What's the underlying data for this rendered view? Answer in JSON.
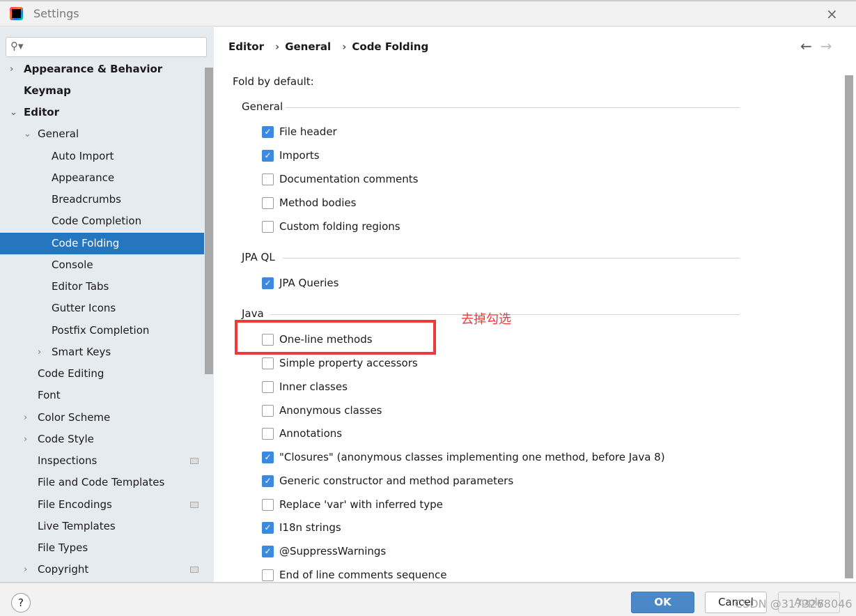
{
  "window": {
    "title": "Settings",
    "close_icon": "×"
  },
  "sidebar": {
    "search_placeholder": "",
    "items": [
      {
        "label": "Appearance & Behavior",
        "level": 0,
        "bold": true,
        "arrow": "›"
      },
      {
        "label": "Keymap",
        "level": 0,
        "bold": true
      },
      {
        "label": "Editor",
        "level": 0,
        "bold": true,
        "arrow": "⌄"
      },
      {
        "label": "General",
        "level": 1,
        "arrow": "⌄"
      },
      {
        "label": "Auto Import",
        "level": 2
      },
      {
        "label": "Appearance",
        "level": 2
      },
      {
        "label": "Breadcrumbs",
        "level": 2
      },
      {
        "label": "Code Completion",
        "level": 2
      },
      {
        "label": "Code Folding",
        "level": 2,
        "selected": true
      },
      {
        "label": "Console",
        "level": 2
      },
      {
        "label": "Editor Tabs",
        "level": 2
      },
      {
        "label": "Gutter Icons",
        "level": 2
      },
      {
        "label": "Postfix Completion",
        "level": 2
      },
      {
        "label": "Smart Keys",
        "level": 2,
        "arrow": "›"
      },
      {
        "label": "Code Editing",
        "level": 1
      },
      {
        "label": "Font",
        "level": 1
      },
      {
        "label": "Color Scheme",
        "level": 1,
        "arrow": "›"
      },
      {
        "label": "Code Style",
        "level": 1,
        "arrow": "›"
      },
      {
        "label": "Inspections",
        "level": 1,
        "badge": true
      },
      {
        "label": "File and Code Templates",
        "level": 1
      },
      {
        "label": "File Encodings",
        "level": 1,
        "badge": true
      },
      {
        "label": "Live Templates",
        "level": 1
      },
      {
        "label": "File Types",
        "level": 1
      },
      {
        "label": "Copyright",
        "level": 1,
        "arrow": "›",
        "badge": true
      }
    ]
  },
  "breadcrumb": [
    "Editor",
    "General",
    "Code Folding"
  ],
  "nav": {
    "back": "←",
    "forward": "→"
  },
  "main": {
    "heading": "Fold by default:",
    "groups": [
      {
        "title": "General",
        "options": [
          {
            "label": "File header",
            "checked": true
          },
          {
            "label": "Imports",
            "checked": true
          },
          {
            "label": "Documentation comments",
            "checked": false
          },
          {
            "label": "Method bodies",
            "checked": false
          },
          {
            "label": "Custom folding regions",
            "checked": false
          }
        ]
      },
      {
        "title": "JPA QL",
        "options": [
          {
            "label": "JPA Queries",
            "checked": true
          }
        ]
      },
      {
        "title": "Java",
        "options": [
          {
            "label": "One-line methods",
            "checked": false
          },
          {
            "label": "Simple property accessors",
            "checked": false
          },
          {
            "label": "Inner classes",
            "checked": false
          },
          {
            "label": "Anonymous classes",
            "checked": false
          },
          {
            "label": "Annotations",
            "checked": false
          },
          {
            "label": "\"Closures\" (anonymous classes implementing one method, before Java 8)",
            "checked": true
          },
          {
            "label": "Generic constructor and method parameters",
            "checked": true
          },
          {
            "label": "Replace 'var' with inferred type",
            "checked": false
          },
          {
            "label": "I18n strings",
            "checked": true
          },
          {
            "label": "@SuppressWarnings",
            "checked": true
          },
          {
            "label": "End of line comments sequence",
            "checked": false
          }
        ]
      }
    ]
  },
  "annotation": {
    "text": "去掉勾选",
    "color": "#f03a3a"
  },
  "footer": {
    "help": "?",
    "ok": "OK",
    "cancel": "Cancel",
    "apply": "Apply",
    "watermark": "CSDN @3173268046"
  }
}
